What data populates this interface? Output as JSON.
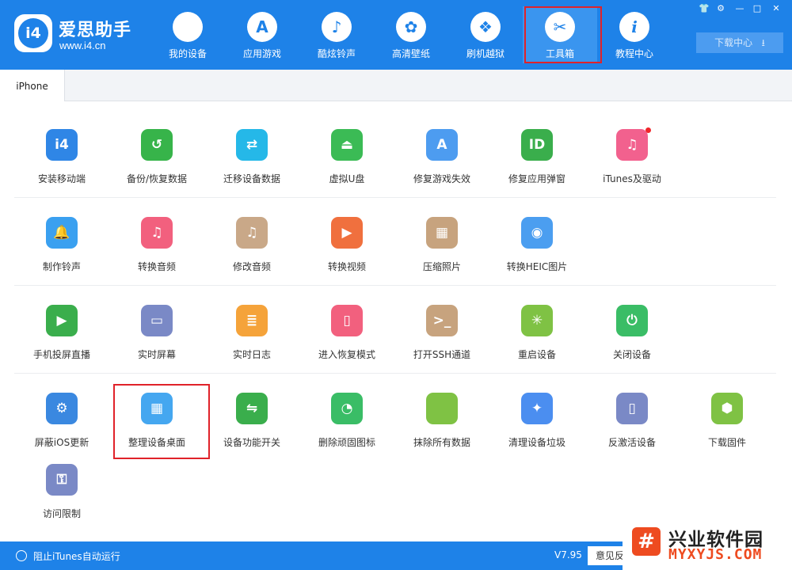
{
  "app": {
    "name": "爱思助手",
    "url": "www.i4.cn",
    "logo_text": "i4"
  },
  "nav": [
    {
      "label": "我的设备",
      "icon": "apple-icon",
      "glyph": ""
    },
    {
      "label": "应用游戏",
      "icon": "app-store-icon",
      "glyph": "A"
    },
    {
      "label": "酷炫铃声",
      "icon": "bell-icon",
      "glyph": "♪"
    },
    {
      "label": "高清壁纸",
      "icon": "flower-icon",
      "glyph": "✿"
    },
    {
      "label": "刷机越狱",
      "icon": "dropbox-icon",
      "glyph": "❖"
    },
    {
      "label": "工具箱",
      "icon": "tools-icon",
      "glyph": "✂"
    },
    {
      "label": "教程中心",
      "icon": "info-icon",
      "glyph": "i"
    }
  ],
  "active_nav": "工具箱",
  "window_controls": {
    "skin": "👕",
    "settings": "⚙",
    "minimize": "—",
    "maximize": "□",
    "close": "✕"
  },
  "download_center": "下载中心",
  "tab": "iPhone",
  "tools": [
    {
      "label": "安装移动端",
      "icon": "i4-install-icon",
      "glyph": "i4",
      "color": "#2f86e6"
    },
    {
      "label": "备份/恢复数据",
      "icon": "backup-restore-icon",
      "glyph": "↺",
      "color": "#37b44a"
    },
    {
      "label": "迁移设备数据",
      "icon": "migrate-data-icon",
      "glyph": "⇄",
      "color": "#25b8e8"
    },
    {
      "label": "虚拟U盘",
      "icon": "usb-drive-icon",
      "glyph": "⏏",
      "color": "#3bbb55"
    },
    {
      "label": "修复游戏失效",
      "icon": "app-store-repair-icon",
      "glyph": "A",
      "color": "#4d9cf0"
    },
    {
      "label": "修复应用弹窗",
      "icon": "apple-id-icon",
      "glyph": "ID",
      "color": "#3aae4c"
    },
    {
      "label": "iTunes及驱动",
      "icon": "itunes-icon",
      "glyph": "♫",
      "color": "#f2618e"
    },
    {
      "label": "制作铃声",
      "icon": "ringtone-bell-icon",
      "glyph": "🔔",
      "color": "#3aa0f0"
    },
    {
      "label": "转换音频",
      "icon": "convert-audio-icon",
      "glyph": "♫",
      "color": "#f2607e"
    },
    {
      "label": "修改音频",
      "icon": "edit-audio-icon",
      "glyph": "♫",
      "color": "#c9a888"
    },
    {
      "label": "转换视频",
      "icon": "convert-video-icon",
      "glyph": "▶",
      "color": "#f0703e"
    },
    {
      "label": "压缩照片",
      "icon": "compress-photo-icon",
      "glyph": "▦",
      "color": "#c7a37e"
    },
    {
      "label": "转换HEIC图片",
      "icon": "heic-convert-icon",
      "glyph": "◉",
      "color": "#4b9ef0"
    },
    {
      "label": "手机投屏直播",
      "icon": "screen-cast-icon",
      "glyph": "▶",
      "color": "#3aae4c"
    },
    {
      "label": "实时屏幕",
      "icon": "realtime-screen-icon",
      "glyph": "▭",
      "color": "#7a89c6"
    },
    {
      "label": "实时日志",
      "icon": "realtime-log-icon",
      "glyph": "≣",
      "color": "#f5a33a"
    },
    {
      "label": "进入恢复模式",
      "icon": "recovery-mode-icon",
      "glyph": "▯",
      "color": "#f2607e"
    },
    {
      "label": "打开SSH通道",
      "icon": "ssh-terminal-icon",
      "glyph": ">_",
      "color": "#c7a37e"
    },
    {
      "label": "重启设备",
      "icon": "restart-icon",
      "glyph": "✳",
      "color": "#7fc244"
    },
    {
      "label": "关闭设备",
      "icon": "power-icon",
      "glyph": "⏻",
      "color": "#3abd66"
    },
    {
      "label": "屏蔽iOS更新",
      "icon": "block-update-icon",
      "glyph": "⚙",
      "color": "#3a88e0"
    },
    {
      "label": "整理设备桌面",
      "icon": "organize-desktop-icon",
      "glyph": "▦",
      "color": "#45a7f0"
    },
    {
      "label": "设备功能开关",
      "icon": "feature-toggle-icon",
      "glyph": "⇋",
      "color": "#3aae4c"
    },
    {
      "label": "删除顽固图标",
      "icon": "delete-icon-icon",
      "glyph": "◔",
      "color": "#3abd66"
    },
    {
      "label": "抹除所有数据",
      "icon": "erase-data-icon",
      "glyph": "",
      "color": "#7fc244"
    },
    {
      "label": "清理设备垃圾",
      "icon": "clean-junk-icon",
      "glyph": "✦",
      "color": "#4b8ef0"
    },
    {
      "label": "反激活设备",
      "icon": "deactivate-icon",
      "glyph": "▯",
      "color": "#7a89c6"
    },
    {
      "label": "下载固件",
      "icon": "firmware-cube-icon",
      "glyph": "⬢",
      "color": "#7fc244"
    },
    {
      "label": "访问限制",
      "icon": "restrictions-key-icon",
      "glyph": "⚿",
      "color": "#7a89c6"
    }
  ],
  "highlighted_tool": "整理设备桌面",
  "status": {
    "itunes_block": "阻止iTunes自动运行",
    "version": "V7.95",
    "feedback": "意见反"
  },
  "watermark": {
    "name": "兴业软件园",
    "url": "MYXYJS.COM",
    "logo_glyph": "#"
  }
}
